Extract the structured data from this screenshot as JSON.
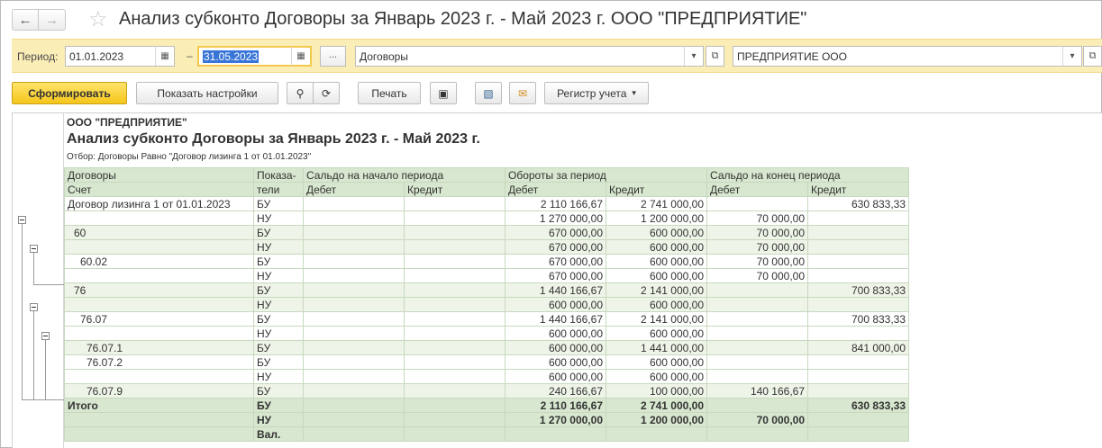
{
  "window": {
    "title": "Анализ субконто Договоры за Январь 2023 г. - Май 2023 г. ООО \"ПРЕДПРИЯТИЕ\""
  },
  "params": {
    "period_label": "Период:",
    "date_from": "01.01.2023",
    "date_to": "31.05.2023",
    "dash": "–",
    "dots": "...",
    "subconto": "Договоры",
    "organization": "ПРЕДПРИЯТИЕ ООО"
  },
  "toolbar": {
    "generate": "Сформировать",
    "show_settings": "Показать настройки",
    "print": "Печать",
    "register": "Регистр учета"
  },
  "report": {
    "org": "ООО \"ПРЕДПРИЯТИЕ\"",
    "title": "Анализ субконто Договоры за Январь 2023 г. - Май 2023 г.",
    "filter": "Отбор: Договоры Равно \"Договор лизинга 1 от 01.01.2023\"",
    "headers": {
      "dogovory": "Договоры",
      "schet": "Счет",
      "pokaza": "Показа-",
      "teli": "тели",
      "saldo_start": "Сальдо на начало периода",
      "turnover": "Обороты за период",
      "saldo_end": "Сальдо на конец периода",
      "debet": "Дебет",
      "kredit": "Кредит"
    },
    "rows": [
      {
        "name": "Договор лизинга 1 от 01.01.2023",
        "ind": "БУ",
        "sd": "",
        "sk": "",
        "od": "2 110 166,67",
        "ok": "2 741 000,00",
        "ed": "",
        "ek": "630 833,33"
      },
      {
        "name": "",
        "ind": "НУ",
        "sd": "",
        "sk": "",
        "od": "1 270 000,00",
        "ok": "1 200 000,00",
        "ed": "70 000,00",
        "ek": ""
      },
      {
        "name": "60",
        "ind": "БУ",
        "sd": "",
        "sk": "",
        "od": "670 000,00",
        "ok": "600 000,00",
        "ed": "70 000,00",
        "ek": ""
      },
      {
        "name": "",
        "ind": "НУ",
        "sd": "",
        "sk": "",
        "od": "670 000,00",
        "ok": "600 000,00",
        "ed": "70 000,00",
        "ek": ""
      },
      {
        "name": "60.02",
        "ind": "БУ",
        "sd": "",
        "sk": "",
        "od": "670 000,00",
        "ok": "600 000,00",
        "ed": "70 000,00",
        "ek": ""
      },
      {
        "name": "",
        "ind": "НУ",
        "sd": "",
        "sk": "",
        "od": "670 000,00",
        "ok": "600 000,00",
        "ed": "70 000,00",
        "ek": ""
      },
      {
        "name": "76",
        "ind": "БУ",
        "sd": "",
        "sk": "",
        "od": "1 440 166,67",
        "ok": "2 141 000,00",
        "ed": "",
        "ek": "700 833,33"
      },
      {
        "name": "",
        "ind": "НУ",
        "sd": "",
        "sk": "",
        "od": "600 000,00",
        "ok": "600 000,00",
        "ed": "",
        "ek": ""
      },
      {
        "name": "76.07",
        "ind": "БУ",
        "sd": "",
        "sk": "",
        "od": "1 440 166,67",
        "ok": "2 141 000,00",
        "ed": "",
        "ek": "700 833,33"
      },
      {
        "name": "",
        "ind": "НУ",
        "sd": "",
        "sk": "",
        "od": "600 000,00",
        "ok": "600 000,00",
        "ed": "",
        "ek": ""
      },
      {
        "name": "76.07.1",
        "ind": "БУ",
        "sd": "",
        "sk": "",
        "od": "600 000,00",
        "ok": "1 441 000,00",
        "ed": "",
        "ek": "841 000,00"
      },
      {
        "name": "76.07.2",
        "ind": "БУ",
        "sd": "",
        "sk": "",
        "od": "600 000,00",
        "ok": "600 000,00",
        "ed": "",
        "ek": ""
      },
      {
        "name": "",
        "ind": "НУ",
        "sd": "",
        "sk": "",
        "od": "600 000,00",
        "ok": "600 000,00",
        "ed": "",
        "ek": ""
      },
      {
        "name": "76.07.9",
        "ind": "БУ",
        "sd": "",
        "sk": "",
        "od": "240 166,67",
        "ok": "100 000,00",
        "ed": "140 166,67",
        "ek": ""
      }
    ],
    "totals": [
      {
        "name": "Итого",
        "ind": "БУ",
        "sd": "",
        "sk": "",
        "od": "2 110 166,67",
        "ok": "2 741 000,00",
        "ed": "",
        "ek": "630 833,33"
      },
      {
        "name": "",
        "ind": "НУ",
        "sd": "",
        "sk": "",
        "od": "1 270 000,00",
        "ok": "1 200 000,00",
        "ed": "70 000,00",
        "ek": ""
      },
      {
        "name": "",
        "ind": "Вал.",
        "sd": "",
        "sk": "",
        "od": "",
        "ok": "",
        "ed": "",
        "ek": ""
      }
    ]
  },
  "colors": {
    "header_bg": "#d8e7cf",
    "params_bg": "#fbedb6",
    "primary_btn": "#f5c51a"
  }
}
